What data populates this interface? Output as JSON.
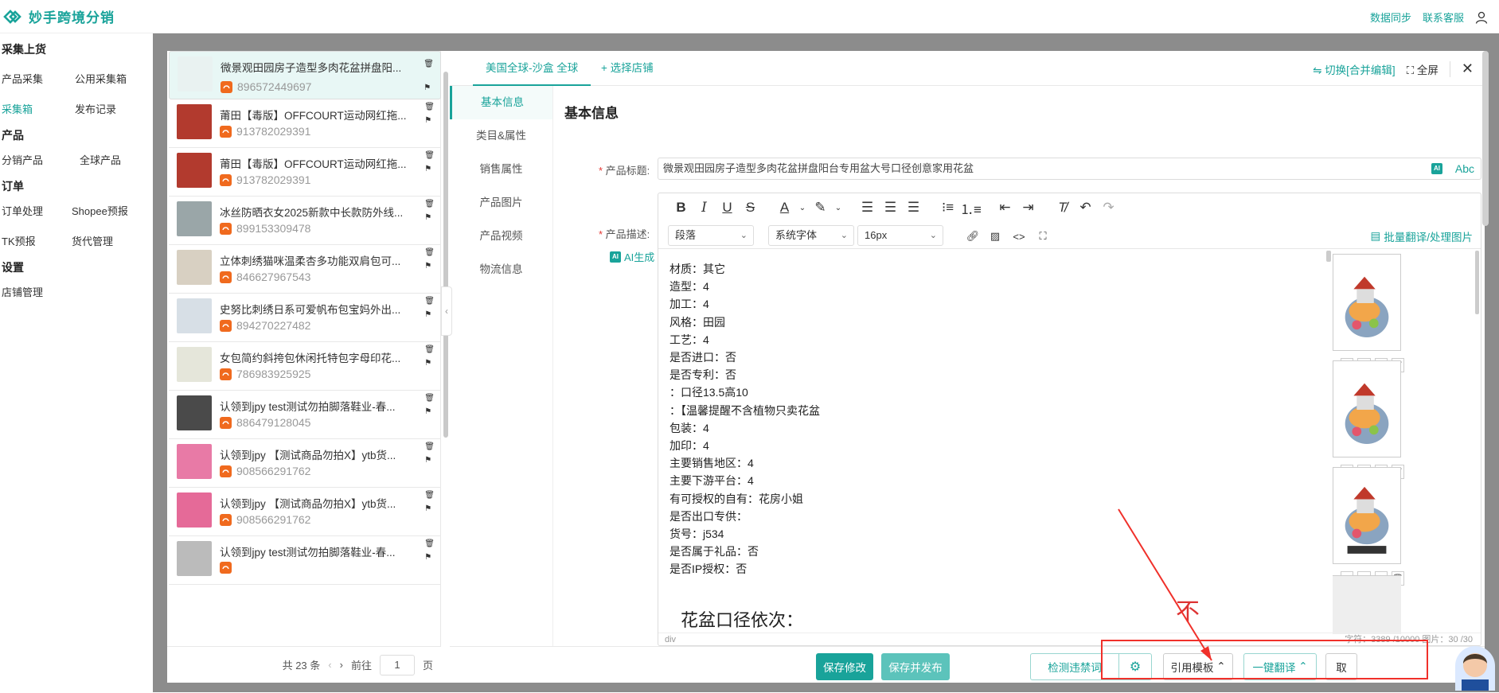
{
  "app": {
    "name": "妙手跨境分销",
    "links": [
      "数据同步",
      "联系客服"
    ]
  },
  "sidebar": {
    "groups": [
      {
        "title": "采集上货",
        "items": [
          "产品采集",
          "公用采集箱",
          "采集箱",
          "发布记录"
        ]
      },
      {
        "title": "产品",
        "items": [
          "分销产品",
          "全球产品"
        ]
      },
      {
        "title": "订单",
        "items": [
          "订单处理",
          "Shopee预报",
          "TK预报",
          "货代管理"
        ]
      },
      {
        "title": "设置",
        "items": [
          "店铺管理"
        ]
      }
    ]
  },
  "products": [
    {
      "title": "微景观田园房子造型多肉花盆拼盘阳...",
      "id": "896572449697"
    },
    {
      "title": "莆田【毒版】OFFCOURT运动网红拖...",
      "id": "913782029391"
    },
    {
      "title": "莆田【毒版】OFFCOURT运动网红拖...",
      "id": "913782029391"
    },
    {
      "title": "冰丝防晒衣女2025新款中长款防外线...",
      "id": "899153309478"
    },
    {
      "title": "立体刺绣猫咪温柔杏多功能双肩包可...",
      "id": "846627967543"
    },
    {
      "title": "史努比刺绣日系可爱帆布包宝妈外出...",
      "id": "894270227482"
    },
    {
      "title": "女包简约斜挎包休闲托特包字母印花...",
      "id": "786983925925"
    },
    {
      "title": "认领到jpy test测试勿拍脚落鞋业-春...",
      "id": "886479128045"
    },
    {
      "title": "认领到jpy 【测试商品勿拍X】ytb货...",
      "id": "908566291762"
    },
    {
      "title": "认领到jpy 【测试商品勿拍X】ytb货...",
      "id": "908566291762"
    },
    {
      "title": "认领到jpy test测试勿拍脚落鞋业-春...",
      "id": ""
    }
  ],
  "pagination": {
    "total": "共 23 条",
    "goto": "前往",
    "page": "1",
    "unit": "页"
  },
  "tabs": {
    "store": "美国全球-沙盒 全球",
    "add_store": "+ 选择店铺",
    "switch": "切换[合并编辑]",
    "fullscreen": "全屏"
  },
  "anchors": [
    "基本信息",
    "类目&属性",
    "销售属性",
    "产品图片",
    "产品视频",
    "物流信息"
  ],
  "form": {
    "section": "基本信息",
    "title_label": "产品标题:",
    "title_value": "微景观田园房子造型多肉花盆拼盘阳台专用盆大号口径创意家用花盆",
    "desc_label": "产品描述:",
    "ai_generate": "AI生成",
    "abc": "Abc",
    "ai": "AI"
  },
  "toolbar": {
    "paragraph": "段落",
    "font": "系统字体",
    "size": "16px",
    "batch": "批量翻译/处理图片"
  },
  "description_lines": [
    "材质：其它",
    "造型：4",
    "加工：4",
    "风格：田园",
    "工艺：4",
    "是否进口：否",
    "是否专利：否",
    "：口径13.5高10",
    "：【温馨提醒不含植物只卖花盆",
    "包装：4",
    "加印：4",
    "主要销售地区：4",
    "主要下游平台：4",
    "有可授权的自有：花房小姐",
    "是否出口专供：",
    "货号：j534",
    "是否属于礼品：否",
    "是否IP授权：否"
  ],
  "description_big": "花盆口径依次：",
  "description_red": "不",
  "editor_status": {
    "path": "div",
    "count": "字符：3389 /10000   图片：30 /30"
  },
  "buttons": {
    "save": "保存修改",
    "save_publish": "保存并发布",
    "detect": "检测违禁词",
    "template": "引用模板",
    "translate": "一键翻译",
    "cancel": "取"
  },
  "colors": {
    "accent": "#19a39a",
    "highlight": "#f0302a"
  }
}
